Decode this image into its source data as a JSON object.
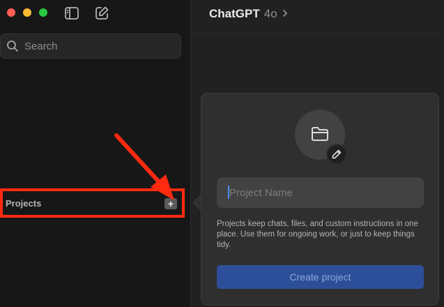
{
  "header": {
    "title": "ChatGPT",
    "model": "4o"
  },
  "sidebar": {
    "search": {
      "placeholder": "Search"
    },
    "projects": {
      "label": "Projects",
      "add_label": "+"
    }
  },
  "popover": {
    "name_placeholder": "Project Name",
    "description": "Projects keep chats, files, and custom instructions in one place. Use them for ongoing work, or just to keep things tidy.",
    "create_label": "Create project"
  },
  "icons": {
    "window_close": "close-traffic-light",
    "window_minimize": "minimize-traffic-light",
    "window_zoom": "zoom-traffic-light",
    "sidebar_toggle": "sidebar-toggle-icon",
    "compose": "compose-icon",
    "search": "search-icon",
    "folder": "folder-icon",
    "edit": "pencil-icon",
    "model_chevron": "chevron-right-icon",
    "annotation": "red-arrow-annotation"
  },
  "colors": {
    "annotation": "#ff2a0f",
    "primary_button": "#2d4f9a",
    "caret": "#4a8cf7",
    "close": "#ff5f57",
    "minimize": "#febc2e",
    "zoom": "#28c840"
  }
}
